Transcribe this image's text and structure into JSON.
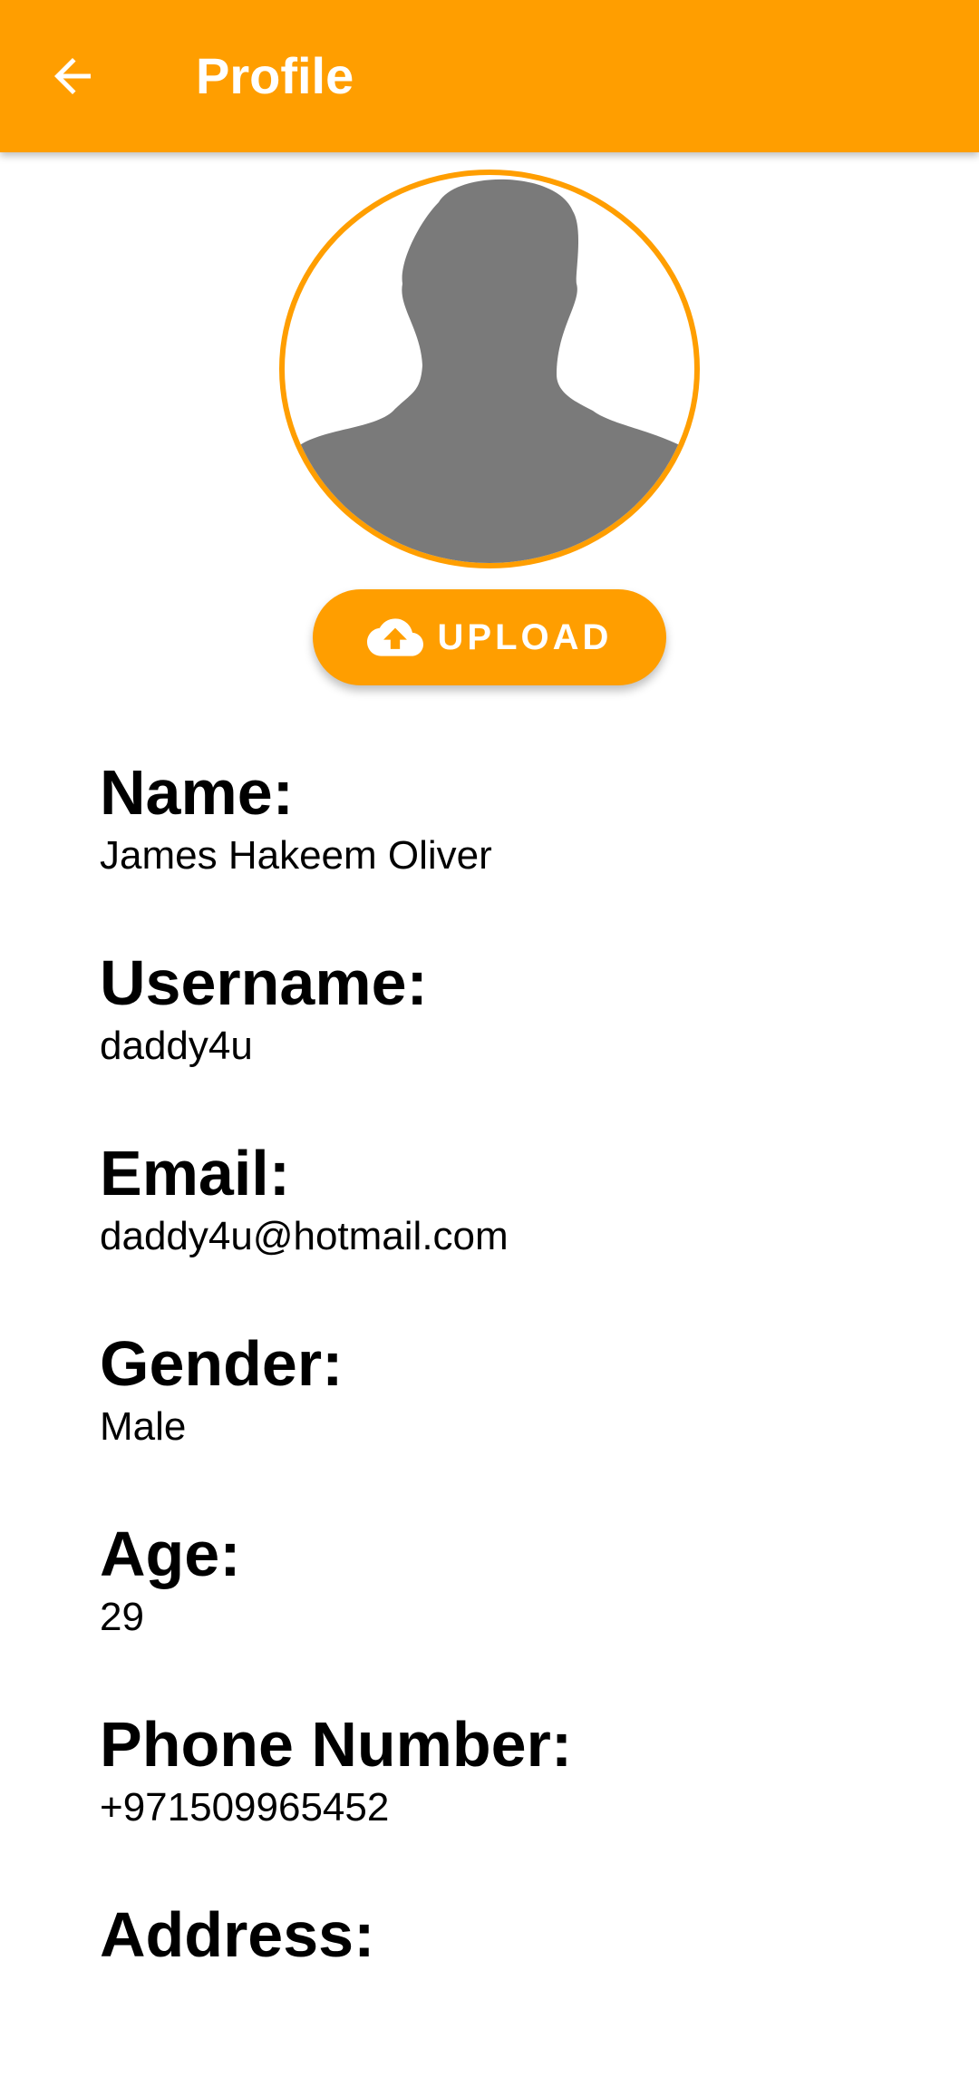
{
  "app_bar": {
    "title": "Profile",
    "back_icon": "arrow-back-icon",
    "color": "#FF9E00"
  },
  "avatar": {
    "icon": "person-silhouette-icon",
    "border_color": "#FF9E00"
  },
  "upload_button": {
    "label": "UPLOAD",
    "icon": "cloud-upload-icon"
  },
  "fields": [
    {
      "label": "Name:",
      "value": "James Hakeem Oliver"
    },
    {
      "label": "Username:",
      "value": "daddy4u"
    },
    {
      "label": "Email:",
      "value": "daddy4u@hotmail.com"
    },
    {
      "label": "Gender:",
      "value": "Male"
    },
    {
      "label": "Age:",
      "value": "29"
    },
    {
      "label": "Phone Number:",
      "value": "+971509965452"
    },
    {
      "label": "Address:",
      "value": ""
    }
  ]
}
